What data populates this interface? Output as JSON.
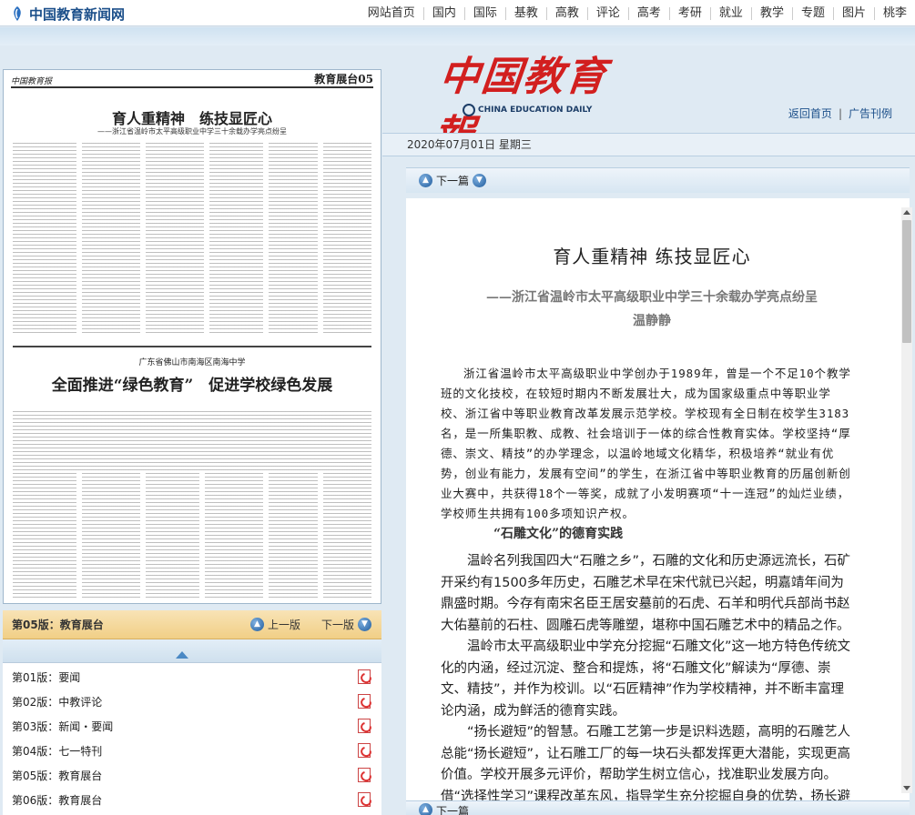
{
  "site": {
    "logo": "中国教育新闻网"
  },
  "nav": [
    "网站首页",
    "国内",
    "国际",
    "基教",
    "高教",
    "评论",
    "高考",
    "考研",
    "就业",
    "教学",
    "专题",
    "图片",
    "桃李"
  ],
  "thumb": {
    "paper_name": "中国教育报",
    "section": "教育展台05",
    "headline": "育人重精神　练技显匠心",
    "subheadline": "——浙江省温岭市太平高级职业中学三十余载办学亮点纷呈",
    "headline2_pre": "广东省佛山市南海区南海中学",
    "headline2": "全面推进“绿色教育”　促进学校绿色发展"
  },
  "pager": {
    "current": "第05版：教育展台",
    "prev": "上一版",
    "next": "下一版"
  },
  "editions": [
    {
      "label": "第01版：要闻"
    },
    {
      "label": "第02版：中教评论"
    },
    {
      "label": "第03版：新闻・要闻"
    },
    {
      "label": "第04版：七一特刊"
    },
    {
      "label": "第05版：教育展台"
    },
    {
      "label": "第06版：教育展台"
    }
  ],
  "masthead": {
    "cn": "中国教育報",
    "en": "CHINA EDUCATION DAILY"
  },
  "header_links": {
    "home": "返回首页",
    "ads": "广告刊例"
  },
  "date": "2020年07月01日  星期三",
  "next_article": "下一篇",
  "article": {
    "title": "育人重精神  练技显匠心",
    "subtitle": "——浙江省温岭市太平高级职业中学三十余载办学亮点纷呈",
    "author": "温静静",
    "p1": "浙江省温岭市太平高级职业中学创办于1989年，曾是一个不足10个教学班的文化技校，在较短时期内不断发展壮大，成为国家级重点中等职业学校、浙江省中等职业教育改革发展示范学校。学校现有全日制在校学生3183名，是一所集职教、成教、社会培训于一体的综合性教育实体。学校坚持“厚德、崇文、精技”的办学理念，以温岭地域文化精华，积极培养“就业有优势，创业有能力，发展有空间”的学生，在浙江省中等职业教育的历届创新创业大赛中，共获得18个一等奖，成就了小发明赛项“十一连冠”的灿烂业绩，学校师生共拥有100多项知识产权。",
    "h3": "“石雕文化”的德育实践",
    "p2": "温岭名列我国四大“石雕之乡”，石雕的文化和历史源远流长，石矿开采约有1500多年历史，石雕艺术早在宋代就已兴起，明嘉靖年间为鼎盛时期。今存有南宋名臣王居安墓前的石虎、石羊和明代兵部尚书赵大佑墓前的石柱、圆雕石虎等雕塑，堪称中国石雕艺术中的精品之作。",
    "p3": "温岭市太平高级职业中学充分挖掘“石雕文化”这一地方特色传统文化的内涵，经过沉淀、整合和提炼，将“石雕文化”解读为“厚德、崇文、精技”，并作为校训。以“石匠精神”作为学校精神，并不断丰富理论内涵，成为鲜活的德育实践。",
    "p4": "“扬长避短”的智慧。石雕工艺第一步是识料选题，高明的石雕艺人总能“扬长避短”，让石雕工厂的每一块石头都发挥更大潜能，实现更高价值。学校开展多元评价，帮助学生树立信心，找准职业发展方向。借“选择性学习”课程改革东风，指导学生充分挖掘自身的优势，扬长避"
  },
  "colors": {
    "accent": "#1b4f8a",
    "brand_red": "#d21f1f",
    "pager_bg": "#f1cf86"
  }
}
